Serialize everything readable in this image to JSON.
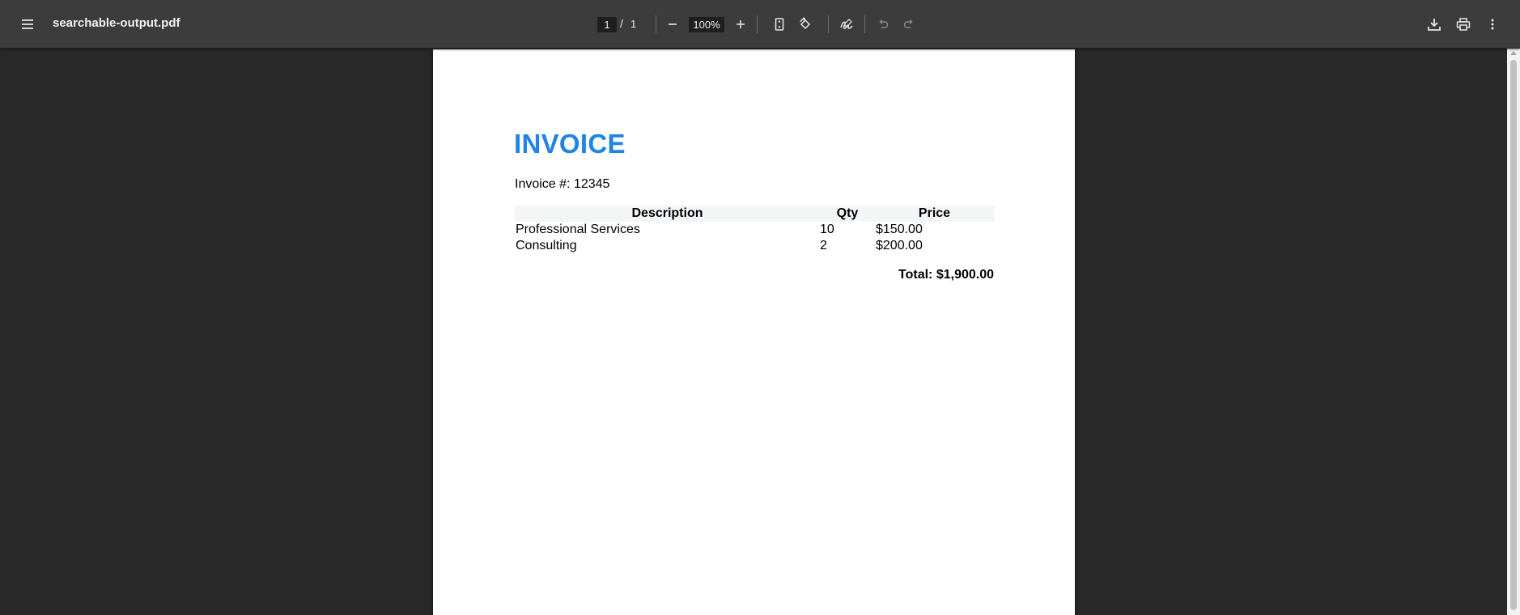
{
  "toolbar": {
    "title": "searchable-output.pdf",
    "page_current": "1",
    "page_separator": "/",
    "page_total": "1",
    "zoom": "100%"
  },
  "icons": {
    "menu": "menu-icon",
    "zoom_out": "minus-icon",
    "zoom_in": "plus-icon",
    "fit_page": "fit-page-icon",
    "rotate": "rotate-icon",
    "annotate": "draw-icon",
    "undo": "undo-icon",
    "redo": "redo-icon",
    "download": "download-icon",
    "print": "print-icon",
    "more": "more-vertical-icon"
  },
  "colors": {
    "toolbar_bg": "#3c3c3c",
    "viewer_bg": "#282828",
    "invoice_title": "#1f83e8"
  },
  "document": {
    "title": "INVOICE",
    "invoice_number": "Invoice #: 12345",
    "table": {
      "headers": [
        "Description",
        "Qty",
        "Price"
      ],
      "rows": [
        [
          "Professional Services",
          "10",
          "$150.00"
        ],
        [
          "Consulting",
          "2",
          "$200.00"
        ]
      ]
    },
    "total": "Total: $1,900.00"
  }
}
